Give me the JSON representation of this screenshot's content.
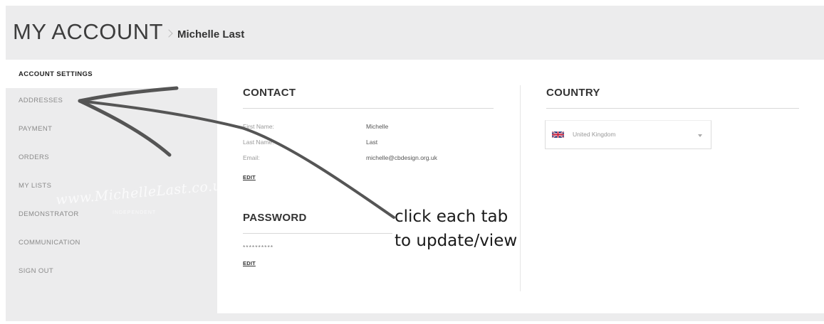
{
  "header": {
    "title": "MY ACCOUNT",
    "user_name": "Michelle Last"
  },
  "sidebar": {
    "items": [
      {
        "label": "ACCOUNT SETTINGS",
        "active": true
      },
      {
        "label": "ADDRESSES",
        "active": false
      },
      {
        "label": "PAYMENT",
        "active": false
      },
      {
        "label": "ORDERS",
        "active": false
      },
      {
        "label": "MY LISTS",
        "active": false
      },
      {
        "label": "DEMONSTRATOR",
        "active": false
      },
      {
        "label": "COMMUNICATION",
        "active": false
      },
      {
        "label": "SIGN OUT",
        "active": false
      }
    ]
  },
  "contact": {
    "title": "CONTACT",
    "fields": [
      {
        "label": "First Name:",
        "value": "Michelle"
      },
      {
        "label": "Last Name:",
        "value": "Last"
      },
      {
        "label": "Email:",
        "value": "michelle@cbdesign.org.uk"
      }
    ],
    "edit_label": "EDIT"
  },
  "password": {
    "title": "PASSWORD",
    "masked_value": "**********",
    "edit_label": "EDIT"
  },
  "country": {
    "title": "COUNTRY",
    "selected": "United Kingdom",
    "flag_icon": "uk-flag-icon"
  },
  "watermark": {
    "text": "www.MichelleLast.co.uk",
    "subtext": "INDEPENDENT"
  },
  "annotation": {
    "line1": "click each tab",
    "line2": "to update/view"
  }
}
